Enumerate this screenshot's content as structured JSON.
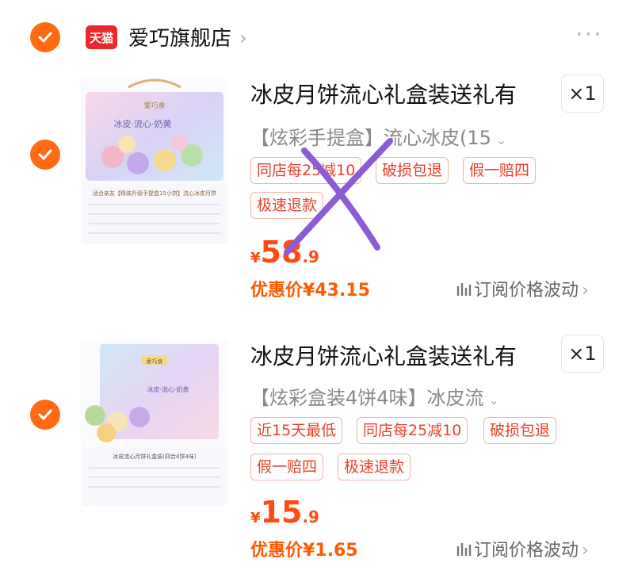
{
  "store": {
    "logo_text": "天猫",
    "name": "爱巧旗舰店",
    "chevron": "›",
    "more": "···"
  },
  "products": [
    {
      "title": "冰皮月饼流心礼盒装送礼有",
      "quantity": "×1",
      "variant": "【炫彩手提盒】流心冰皮(15",
      "variant_caret": "⌄",
      "tags": [
        "同店每25减10",
        "破损包退",
        "假一赔四",
        "极速退款"
      ],
      "price": {
        "currency": "¥",
        "integer": "58",
        "decimal": ".9"
      },
      "discount_price": "优惠价¥43.15",
      "subscribe_label": "订阅价格波动",
      "subscribe_chevron": "›",
      "thumb": {
        "brand": "爱巧食",
        "banner": "冰皮·流心·奶黄",
        "caption": "适合亲友【精装升级手提盒15小饼】流心冰皮月饼"
      },
      "crossed_out": true
    },
    {
      "title": "冰皮月饼流心礼盒装送礼有",
      "quantity": "×1",
      "variant": "【炫彩盒装4饼4味】冰皮流",
      "variant_caret": "⌄",
      "tags": [
        "近15天最低",
        "同店每25减10",
        "破损包退",
        "假一赔四",
        "极速退款"
      ],
      "price": {
        "currency": "¥",
        "integer": "15",
        "decimal": ".9"
      },
      "discount_price": "优惠价¥1.65",
      "subscribe_label": "订阅价格波动",
      "subscribe_chevron": "›",
      "thumb": {
        "brand": "爱巧食",
        "banner": "冰皮·流心·奶黄",
        "caption": "冰皮流心月饼礼盒装(四合4饼4味)"
      },
      "crossed_out": false
    }
  ],
  "colors": {
    "accent": "#ff6a12",
    "price": "#ff4a12",
    "tag_text": "#e8412c",
    "tag_border": "#f2b3a5",
    "cross": "#8b5cd6",
    "tmall_red": "#e9272d"
  }
}
